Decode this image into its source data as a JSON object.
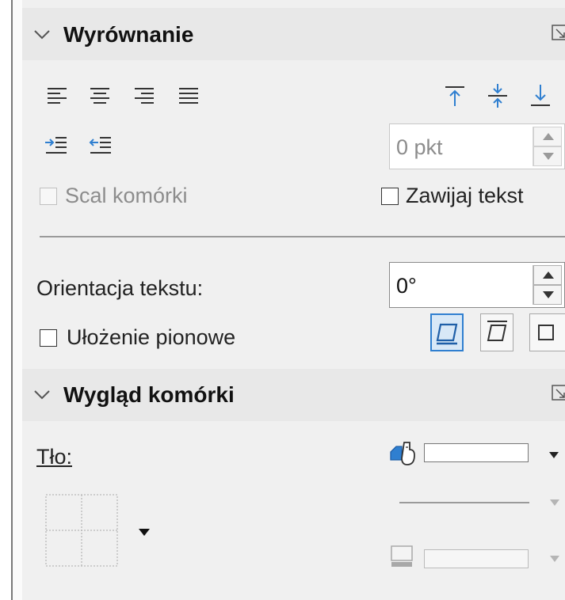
{
  "alignment": {
    "title": "Wyrównanie",
    "indent_value": "0 pkt",
    "merge_cells_label": "Scal komórki",
    "wrap_text_label": "Zawijaj tekst",
    "orientation_label": "Orientacja tekstu:",
    "orientation_value": "0°",
    "vertical_stacking_label": "Ułożenie pionowe",
    "horizontal_icons": [
      "align-left-icon",
      "align-center-icon",
      "align-right-icon",
      "align-justify-icon"
    ],
    "vertical_icons": [
      "align-top-icon",
      "align-middle-icon",
      "align-bottom-icon"
    ],
    "indent_icons": [
      "increase-indent-icon",
      "decrease-indent-icon"
    ]
  },
  "cell_appearance": {
    "title": "Wygląd komórki",
    "background_label": "Tło:"
  },
  "colors": {
    "accent": "#2f7fd0",
    "panel_bg": "#f0f0f0",
    "header_bg": "#e8e8e8"
  }
}
